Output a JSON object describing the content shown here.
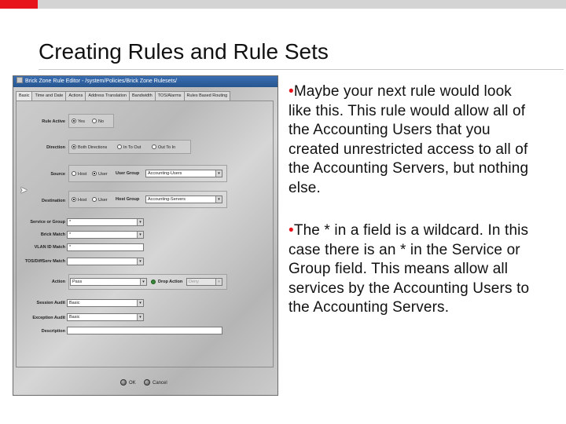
{
  "slide": {
    "title": "Creating Rules and Rule Sets",
    "colors": {
      "accent_red": "#e8141b",
      "bar_gray": "#d4d4d4"
    },
    "bullets": [
      "Maybe your next rule would look like this.  This rule would allow all of the Accounting Users that you created unrestricted access to all of the Accounting Servers, but nothing else.",
      "The * in a field is a wildcard.  In this case there is an * in the Service or Group field. This means allow all services by the Accounting Users to the Accounting Servers."
    ]
  },
  "editor": {
    "window_title": "Brick Zone Rule Editor - /system/Policies/Brick Zone Rulesets/",
    "tabs": [
      "Basic",
      "Time and Date",
      "Actions",
      "Address Translation",
      "Bandwidth",
      "TOS/Alarms",
      "Rules Based Routing"
    ],
    "active_tab": "Basic",
    "fields": {
      "rule_active": {
        "label": "Rule Active",
        "options": [
          "Yes",
          "No"
        ],
        "selected": "Yes"
      },
      "direction": {
        "label": "Direction",
        "options": [
          "Both Directions",
          "In To Out",
          "Out To In"
        ],
        "selected": "Both Directions"
      },
      "source": {
        "label": "Source",
        "options": [
          "Host",
          "User"
        ],
        "selected": "User",
        "sub_label": "User Group",
        "value": "Accounting-Users"
      },
      "destination": {
        "label": "Destination",
        "options": [
          "Host",
          "User"
        ],
        "selected": "Host",
        "sub_label": "Host Group",
        "value": "Accounting-Servers"
      },
      "service_or_group": {
        "label": "Service or Group",
        "value": "*"
      },
      "brick_match": {
        "label": "Brick Match",
        "value": "*"
      },
      "vlan_id_match": {
        "label": "VLAN ID Match",
        "value": "*"
      },
      "tos_diffserv_match": {
        "label": "TOS/DiffServ Match",
        "value": ""
      },
      "action": {
        "label": "Action",
        "value": "Pass",
        "sub_label": "Drop Action",
        "sub_value": "Deny"
      },
      "session_audit": {
        "label": "Session Audit",
        "value": "Basic"
      },
      "exception_audit": {
        "label": "Exception Audit",
        "value": "Basic"
      },
      "description": {
        "label": "Description",
        "value": ""
      }
    },
    "buttons": {
      "ok": "OK",
      "cancel": "Cancel"
    }
  }
}
